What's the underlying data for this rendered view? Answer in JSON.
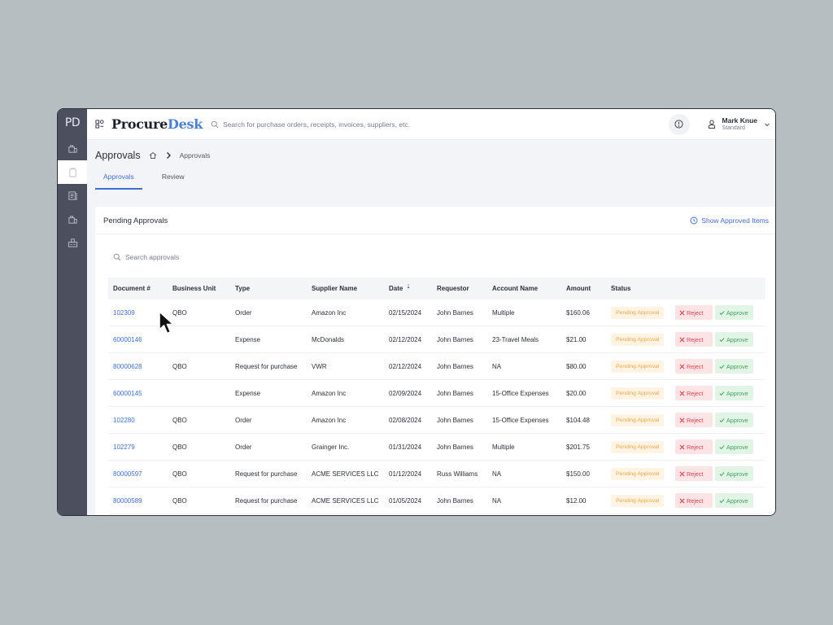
{
  "sidebar": {
    "logo": "PD"
  },
  "header": {
    "brand_part1": "Procure",
    "brand_part2": "Desk",
    "search_placeholder": "Search for purchase orders, receipts, invoices, suppliers, etc.",
    "user_name": "Mark Knue",
    "user_role": "Standard"
  },
  "page": {
    "title": "Approvals",
    "breadcrumb": "Approvals",
    "tabs": [
      {
        "label": "Approvals"
      },
      {
        "label": "Review"
      }
    ]
  },
  "card": {
    "title": "Pending Approvals",
    "show_approved_label": "Show Approved Items",
    "search_placeholder": "Search approvals"
  },
  "table": {
    "headers": [
      "Document #",
      "Business Unit",
      "Type",
      "Supplier Name",
      "Date",
      "Requestor",
      "Account Name",
      "Amount",
      "Status"
    ],
    "reject_label": "Reject",
    "approve_label": "Approve",
    "rows": [
      {
        "doc": "102309",
        "bu": "QBO",
        "type": "Order",
        "supplier": "Amazon Inc",
        "date": "02/15/2024",
        "requestor": "John Barnes",
        "account": "Multiple",
        "amount": "$160.06",
        "status": "Pending Approval"
      },
      {
        "doc": "60000146",
        "bu": "",
        "type": "Expense",
        "supplier": "McDonalds",
        "date": "02/12/2024",
        "requestor": "John Barnes",
        "account": "23-Travel Meals",
        "amount": "$21.00",
        "status": "Pending Approval"
      },
      {
        "doc": "80000628",
        "bu": "QBO",
        "type": "Request for purchase",
        "supplier": "VWR",
        "date": "02/12/2024",
        "requestor": "John Barnes",
        "account": "NA",
        "amount": "$80.00",
        "status": "Pending Approval"
      },
      {
        "doc": "60000145",
        "bu": "",
        "type": "Expense",
        "supplier": "Amazon Inc",
        "date": "02/09/2024",
        "requestor": "John Barnes",
        "account": "15-Office Expenses",
        "amount": "$20.00",
        "status": "Pending Approval"
      },
      {
        "doc": "102280",
        "bu": "QBO",
        "type": "Order",
        "supplier": "Amazon Inc",
        "date": "02/08/2024",
        "requestor": "John Barnes",
        "account": "15-Office Expenses",
        "amount": "$104.48",
        "status": "Pending Approval"
      },
      {
        "doc": "102279",
        "bu": "QBO",
        "type": "Order",
        "supplier": "Grainger Inc.",
        "date": "01/31/2024",
        "requestor": "John Barnes",
        "account": "Multiple",
        "amount": "$201.75",
        "status": "Pending Approval"
      },
      {
        "doc": "80000597",
        "bu": "QBO",
        "type": "Request for purchase",
        "supplier": "ACME SERVICES LLC",
        "date": "01/12/2024",
        "requestor": "Russ Williams",
        "account": "NA",
        "amount": "$150.00",
        "status": "Pending Approval"
      },
      {
        "doc": "80000589",
        "bu": "QBO",
        "type": "Request for purchase",
        "supplier": "ACME SERVICES LLC",
        "date": "01/05/2024",
        "requestor": "John Barnes",
        "account": "NA",
        "amount": "$12.00",
        "status": "Pending Approval"
      }
    ]
  },
  "colors": {
    "accent": "#3e6fd0",
    "sidebar": "#4c4f5e",
    "pending": "#f2a743",
    "reject": "#d9434f",
    "approve": "#3fa65a"
  },
  "icons": [
    "menu-icon",
    "search-icon",
    "alert-icon",
    "user-icon",
    "chevron-down-icon",
    "home-icon",
    "chevron-right-icon",
    "history-icon",
    "close-icon",
    "check-icon",
    "sort-down-icon",
    "cursor-icon"
  ]
}
